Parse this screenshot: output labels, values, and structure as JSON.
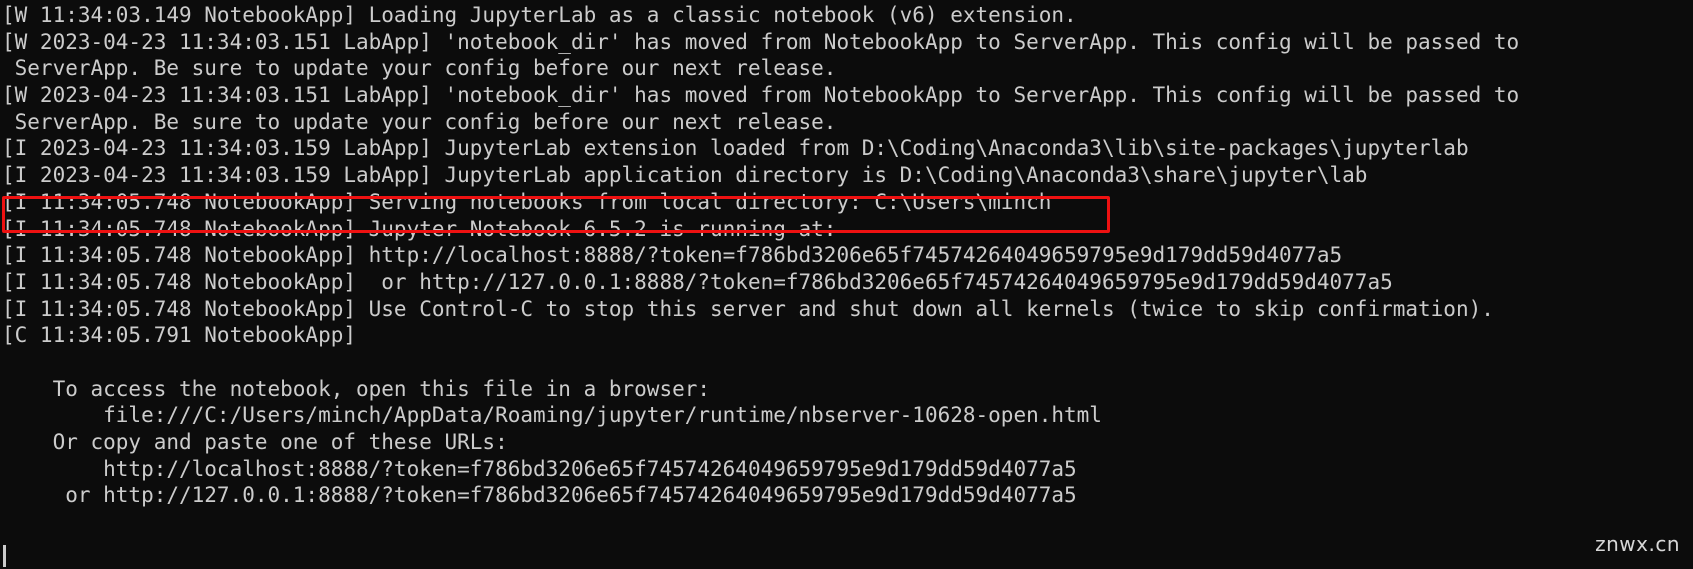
{
  "terminal": {
    "background_color": "#0c0c0c",
    "foreground_color": "#cccccc",
    "lines": [
      "[W 11:34:03.149 NotebookApp] Loading JupyterLab as a classic notebook (v6) extension.",
      "[W 2023-04-23 11:34:03.151 LabApp] 'notebook_dir' has moved from NotebookApp to ServerApp. This config will be passed to",
      " ServerApp. Be sure to update your config before our next release.",
      "[W 2023-04-23 11:34:03.151 LabApp] 'notebook_dir' has moved from NotebookApp to ServerApp. This config will be passed to",
      " ServerApp. Be sure to update your config before our next release.",
      "[I 2023-04-23 11:34:03.159 LabApp] JupyterLab extension loaded from D:\\Coding\\Anaconda3\\lib\\site-packages\\jupyterlab",
      "[I 2023-04-23 11:34:03.159 LabApp] JupyterLab application directory is D:\\Coding\\Anaconda3\\share\\jupyter\\lab",
      "[I 11:34:05.748 NotebookApp] Serving notebooks from local directory: C:\\Users\\minch",
      "[I 11:34:05.748 NotebookApp] Jupyter Notebook 6.5.2 is running at:",
      "[I 11:34:05.748 NotebookApp] http://localhost:8888/?token=f786bd3206e65f74574264049659795e9d179dd59d4077a5",
      "[I 11:34:05.748 NotebookApp]  or http://127.0.0.1:8888/?token=f786bd3206e65f74574264049659795e9d179dd59d4077a5",
      "[I 11:34:05.748 NotebookApp] Use Control-C to stop this server and shut down all kernels (twice to skip confirmation).",
      "[C 11:34:05.791 NotebookApp]",
      "",
      "    To access the notebook, open this file in a browser:",
      "        file:///C:/Users/minch/AppData/Roaming/jupyter/runtime/nbserver-10628-open.html",
      "    Or copy and paste one of these URLs:",
      "        http://localhost:8888/?token=f786bd3206e65f74574264049659795e9d179dd59d4077a5",
      "     or http://127.0.0.1:8888/?token=f786bd3206e65f74574264049659795e9d179dd59d4077a5"
    ]
  },
  "annotation": {
    "highlight_color": "#ee1111",
    "highlighted_line_text": "[I 11:34:05.748 NotebookApp] Serving notebooks from local directory: C:\\Users\\minch"
  },
  "watermark": {
    "text": "znwx.cn"
  },
  "cursor": {
    "color": "#cccccc"
  }
}
